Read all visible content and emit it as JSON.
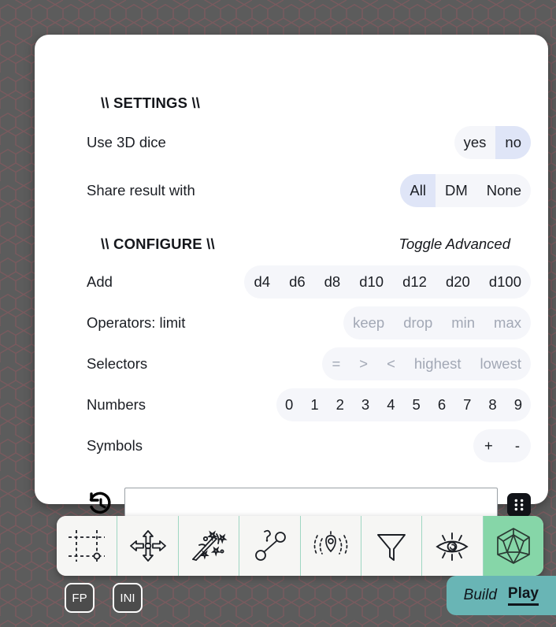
{
  "background": {
    "base_color": "#5a5a5a",
    "hex_line_color": "#7a5a5e"
  },
  "panel": {
    "settings_heading": "\\\\ SETTINGS \\\\",
    "configure_heading": "\\\\ CONFIGURE \\\\",
    "toggle_advanced_label": "Toggle Advanced",
    "settings_rows": [
      {
        "label": "Use 3D dice",
        "options": [
          {
            "text": "yes",
            "selected": false,
            "disabled": false
          },
          {
            "text": "no",
            "selected": true,
            "disabled": false
          }
        ]
      },
      {
        "label": "Share result with",
        "options": [
          {
            "text": "All",
            "selected": true,
            "disabled": false
          },
          {
            "text": "DM",
            "selected": false,
            "disabled": false
          },
          {
            "text": "None",
            "selected": false,
            "disabled": false
          }
        ]
      }
    ],
    "configure_rows": [
      {
        "label": "Add",
        "options": [
          {
            "text": "d4",
            "selected": false,
            "disabled": false
          },
          {
            "text": "d6",
            "selected": false,
            "disabled": false
          },
          {
            "text": "d8",
            "selected": false,
            "disabled": false
          },
          {
            "text": "d10",
            "selected": false,
            "disabled": false
          },
          {
            "text": "d12",
            "selected": false,
            "disabled": false
          },
          {
            "text": "d20",
            "selected": false,
            "disabled": false
          },
          {
            "text": "d100",
            "selected": false,
            "disabled": false
          }
        ]
      },
      {
        "label": "Operators: limit",
        "options": [
          {
            "text": "keep",
            "selected": false,
            "disabled": true
          },
          {
            "text": "drop",
            "selected": false,
            "disabled": true
          },
          {
            "text": "min",
            "selected": false,
            "disabled": true
          },
          {
            "text": "max",
            "selected": false,
            "disabled": true
          }
        ]
      },
      {
        "label": "Selectors",
        "options": [
          {
            "text": "=",
            "selected": false,
            "disabled": true
          },
          {
            "text": ">",
            "selected": false,
            "disabled": true
          },
          {
            "text": "<",
            "selected": false,
            "disabled": true
          },
          {
            "text": "highest",
            "selected": false,
            "disabled": true
          },
          {
            "text": "lowest",
            "selected": false,
            "disabled": true
          }
        ]
      },
      {
        "label": "Numbers",
        "options": [
          {
            "text": "0",
            "selected": false,
            "disabled": false
          },
          {
            "text": "1",
            "selected": false,
            "disabled": false
          },
          {
            "text": "2",
            "selected": false,
            "disabled": false
          },
          {
            "text": "3",
            "selected": false,
            "disabled": false
          },
          {
            "text": "4",
            "selected": false,
            "disabled": false
          },
          {
            "text": "5",
            "selected": false,
            "disabled": false
          },
          {
            "text": "6",
            "selected": false,
            "disabled": false
          },
          {
            "text": "7",
            "selected": false,
            "disabled": false
          },
          {
            "text": "8",
            "selected": false,
            "disabled": false
          },
          {
            "text": "9",
            "selected": false,
            "disabled": false
          }
        ]
      },
      {
        "label": "Symbols",
        "options": [
          {
            "text": "+",
            "selected": false,
            "disabled": false
          },
          {
            "text": "-",
            "selected": false,
            "disabled": false
          }
        ]
      }
    ],
    "formula_input": {
      "value": "",
      "placeholder": ""
    },
    "history_icon": "history-clock-icon",
    "roll_die_icon": "die-six-icon"
  },
  "toolbar": {
    "tools": [
      {
        "icon": "select-area-icon",
        "label": "Select",
        "active": false
      },
      {
        "icon": "move-arrows-icon",
        "label": "Move",
        "active": false
      },
      {
        "icon": "magic-wand-icon",
        "label": "Effects",
        "active": false
      },
      {
        "icon": "measure-link-icon",
        "label": "Measure",
        "active": false
      },
      {
        "icon": "fog-reveal-icon",
        "label": "Fog",
        "active": false
      },
      {
        "icon": "filter-funnel-icon",
        "label": "Filter",
        "active": false
      },
      {
        "icon": "eye-vision-icon",
        "label": "Vision",
        "active": false
      },
      {
        "icon": "d20-dice-icon",
        "label": "Dice",
        "active": true
      }
    ],
    "active_color": "#86d6a8",
    "divider_color": "#9fd6c2"
  },
  "chips": [
    {
      "label": "FP",
      "name": "fp-button"
    },
    {
      "label": "INI",
      "name": "ini-button"
    }
  ],
  "mode_switch": {
    "build_label": "Build",
    "play_label": "Play",
    "active": "Play",
    "background_color": "#69b5b5"
  }
}
